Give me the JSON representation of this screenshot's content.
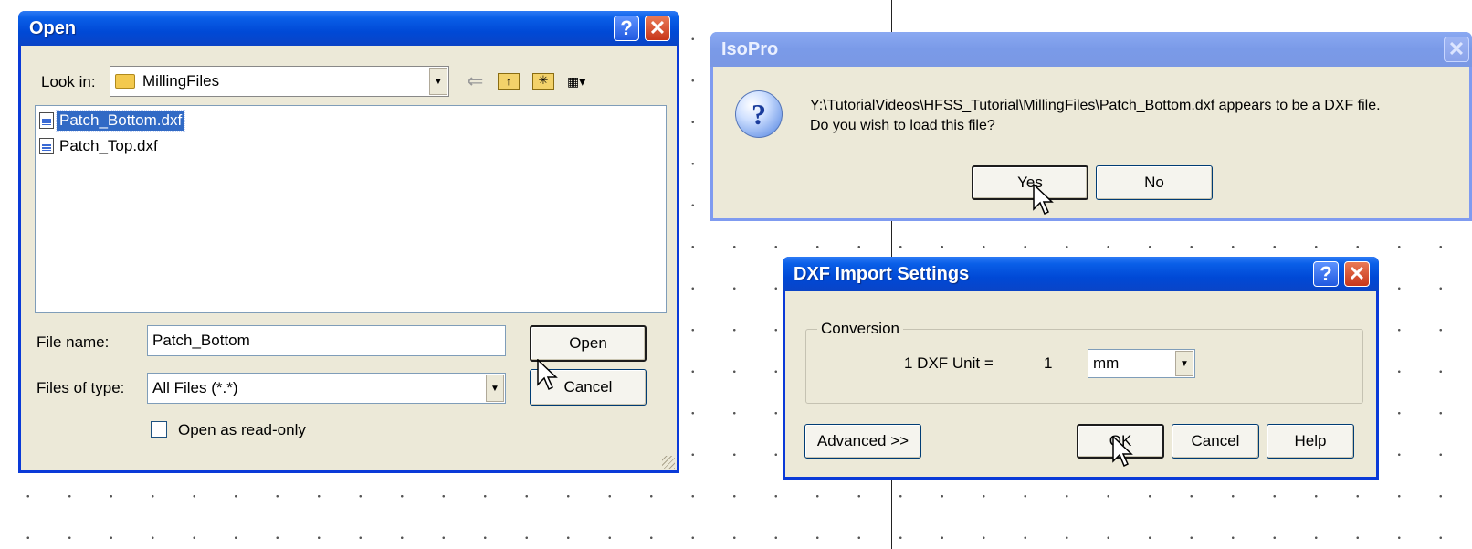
{
  "open_dialog": {
    "title": "Open",
    "look_in_label": "Look in:",
    "look_in_value": "MillingFiles",
    "files": [
      "Patch_Bottom.dxf",
      "Patch_Top.dxf"
    ],
    "file_name_label": "File name:",
    "file_name_value": "Patch_Bottom",
    "files_of_type_label": "Files of type:",
    "files_of_type_value": "All Files (*.*)",
    "open_label": "Open",
    "cancel_label": "Cancel",
    "readonly_label": "Open as read-only"
  },
  "isopro_dialog": {
    "title": "IsoPro",
    "message_line1": "Y:\\TutorialVideos\\HFSS_Tutorial\\MillingFiles\\Patch_Bottom.dxf appears to be a DXF file.",
    "message_line2": "Do you wish to load this file?",
    "yes_label": "Yes",
    "no_label": "No"
  },
  "dxf_dialog": {
    "title": "DXF Import Settings",
    "group_label": "Conversion",
    "unit_label": "1 DXF Unit =",
    "unit_value": "1",
    "unit_select": "mm",
    "advanced_label": "Advanced >>",
    "ok_label": "OK",
    "cancel_label": "Cancel",
    "help_label": "Help"
  },
  "colors": {
    "titlebar_active": "#0a4fd8",
    "titlebar_inactive": "#7a9ae8",
    "dialog_face": "#ece9d8",
    "selection": "#316ac5"
  }
}
